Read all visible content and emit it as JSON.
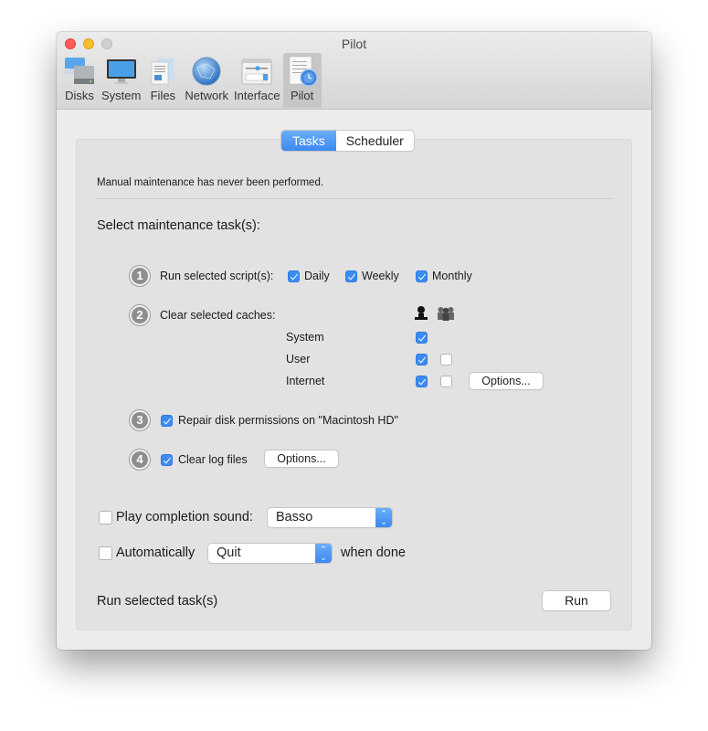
{
  "window": {
    "title": "Pilot",
    "toolbar": [
      {
        "label": "Disks",
        "icon": "disks-icon",
        "active": false
      },
      {
        "label": "System",
        "icon": "display-icon",
        "active": false
      },
      {
        "label": "Files",
        "icon": "files-icon",
        "active": false
      },
      {
        "label": "Network",
        "icon": "network-globe-icon",
        "active": false
      },
      {
        "label": "Interface",
        "icon": "interface-icon",
        "active": false
      },
      {
        "label": "Pilot",
        "icon": "pilot-clock-icon",
        "active": true
      }
    ]
  },
  "tabs": [
    {
      "label": "Tasks",
      "active": true
    },
    {
      "label": "Scheduler",
      "active": false
    }
  ],
  "status_message": "Manual maintenance has never been performed.",
  "section_title": "Select maintenance task(s):",
  "tasks": {
    "scripts": {
      "number": "1",
      "label": "Run selected script(s):",
      "options": [
        {
          "label": "Daily",
          "checked": true
        },
        {
          "label": "Weekly",
          "checked": true
        },
        {
          "label": "Monthly",
          "checked": true
        }
      ]
    },
    "caches": {
      "number": "2",
      "label": "Clear selected caches:",
      "column_icons": [
        "single-user-icon",
        "all-users-icon"
      ],
      "rows": [
        {
          "label": "System",
          "user": true,
          "all_users": null
        },
        {
          "label": "User",
          "user": true,
          "all_users": false
        },
        {
          "label": "Internet",
          "user": true,
          "all_users": false
        }
      ],
      "options_button": "Options..."
    },
    "permissions": {
      "number": "3",
      "label": "Repair disk permissions on \"Macintosh HD\"",
      "checked": true
    },
    "logs": {
      "number": "4",
      "label": "Clear log files",
      "checked": true,
      "options_button": "Options..."
    }
  },
  "sound": {
    "label": "Play completion sound:",
    "checked": false,
    "selected": "Basso"
  },
  "auto": {
    "label": "Automatically",
    "checked": false,
    "selected": "Quit",
    "suffix": "when done"
  },
  "footer": {
    "label": "Run selected task(s)",
    "run_button": "Run"
  },
  "colors": {
    "accent": "#3b8cf2",
    "close": "#fc5b57",
    "minimize": "#fdbc2e",
    "zoom_disabled": "#cfcfcf"
  }
}
